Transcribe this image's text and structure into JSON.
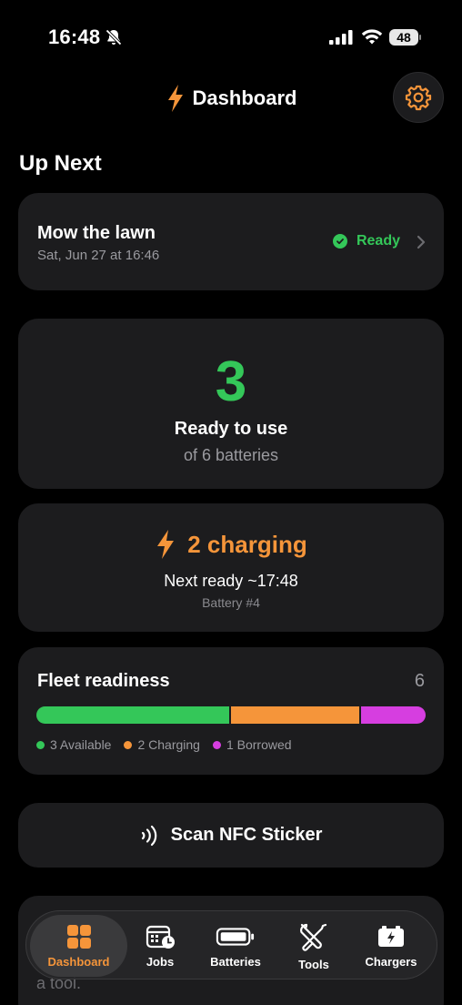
{
  "status_bar": {
    "time": "16:48",
    "battery_level": "48"
  },
  "header": {
    "title": "Dashboard"
  },
  "up_next": {
    "section_title": "Up Next",
    "job_title": "Mow the lawn",
    "job_date": "Sat, Jun 27 at 16:46",
    "status": "Ready"
  },
  "ready_card": {
    "count": "3",
    "label": "Ready to use",
    "sublabel": "of 6 batteries"
  },
  "charging_card": {
    "label": "2 charging",
    "next_ready": "Next ready ~17:48",
    "battery": "Battery #4"
  },
  "fleet": {
    "title": "Fleet readiness",
    "total": "6",
    "segments": [
      {
        "label": "3 Available",
        "count": 3,
        "color": "#34c759"
      },
      {
        "label": "2 Charging",
        "count": 2,
        "color": "#f5953a"
      },
      {
        "label": "1 Borrowed",
        "count": 1,
        "color": "#d63ee0"
      }
    ]
  },
  "scan": {
    "label": "Scan NFC Sticker"
  },
  "peek": {
    "text": "a tool."
  },
  "tabs": [
    {
      "label": "Dashboard",
      "icon": "dashboard-grid-icon",
      "active": true
    },
    {
      "label": "Jobs",
      "icon": "calendar-clock-icon",
      "active": false
    },
    {
      "label": "Batteries",
      "icon": "battery-icon",
      "active": false
    },
    {
      "label": "Tools",
      "icon": "wrench-screwdriver-icon",
      "active": false
    },
    {
      "label": "Chargers",
      "icon": "charger-icon",
      "active": false
    }
  ],
  "colors": {
    "accent": "#f5953a",
    "success": "#34c759",
    "borrowed": "#d63ee0",
    "card": "#1c1c1e",
    "background": "#000000"
  }
}
